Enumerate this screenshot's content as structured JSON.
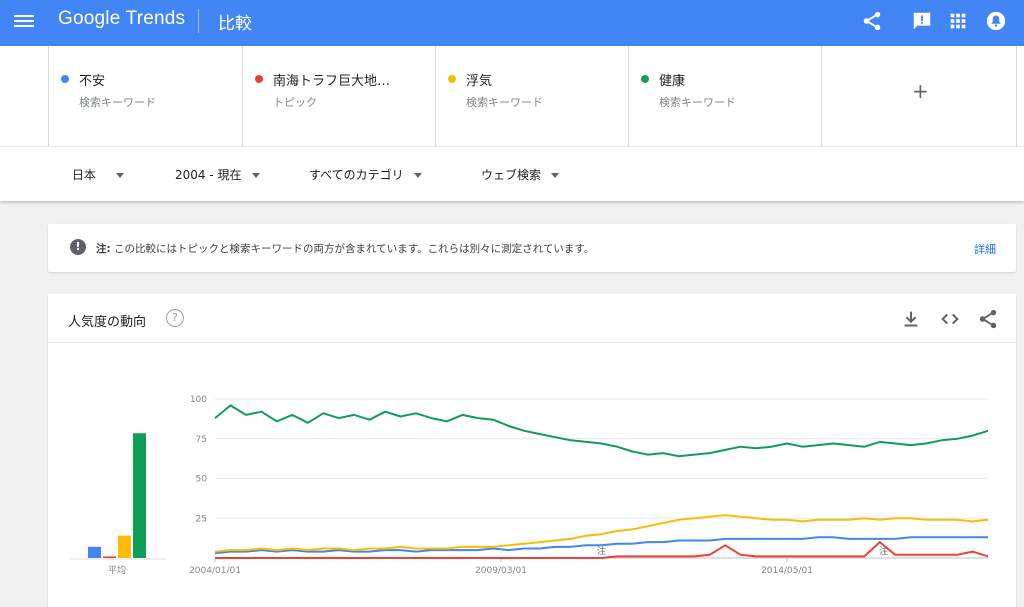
{
  "header": {
    "logo_google": "Google",
    "logo_trends": "Trends",
    "page_title": "比較",
    "icons": [
      "menu-icon",
      "share-icon",
      "feedback-icon",
      "apps-icon",
      "notifications-icon"
    ]
  },
  "terms": [
    {
      "name": "不安",
      "type": "検索キーワード",
      "color": "#4285f4"
    },
    {
      "name": "南海トラフ巨大地…",
      "type": "トピック",
      "color": "#ea4335"
    },
    {
      "name": "浮気",
      "type": "検索キーワード",
      "color": "#fbbc04"
    },
    {
      "name": "健康",
      "type": "検索キーワード",
      "color": "#0f9d58"
    }
  ],
  "add_term_label": "+",
  "filters": {
    "region": "日本",
    "time": "2004 - 現在",
    "category": "すべてのカテゴリ",
    "property": "ウェブ検索"
  },
  "note": {
    "label": "注:",
    "text": "この比較にはトピックと検索キーワードの両方が含まれています。これらは別々に測定されています。",
    "details_label": "詳細"
  },
  "chart_card": {
    "title": "人気度の動向",
    "help_icon": "?",
    "actions": [
      "download-icon",
      "embed-icon",
      "share-icon"
    ]
  },
  "chart_data": {
    "type": "line",
    "y_ticks": [
      "100",
      "75",
      "50",
      "25"
    ],
    "ylim": [
      0,
      100
    ],
    "x_tick_labels": [
      "2004/01/01",
      "2009/03/01",
      "2014/05/01"
    ],
    "x_tick_positions": [
      0,
      0.37,
      0.74
    ],
    "grid": true,
    "annotations": [
      {
        "label": "注",
        "at": 0.5
      },
      {
        "label": "注",
        "at": 0.865
      }
    ],
    "averages": {
      "label": "平均",
      "values": [
        7,
        1,
        14,
        78
      ]
    },
    "series": [
      {
        "name": "不安",
        "color": "#4285f4",
        "values": [
          3,
          4,
          4,
          5,
          4,
          5,
          4,
          4,
          5,
          4,
          4,
          5,
          5,
          4,
          5,
          5,
          5,
          5,
          6,
          5,
          6,
          6,
          7,
          7,
          8,
          8,
          9,
          9,
          10,
          10,
          11,
          11,
          11,
          12,
          12,
          12,
          12,
          12,
          12,
          13,
          13,
          12,
          12,
          12,
          12,
          13,
          13,
          13,
          13,
          13,
          13
        ]
      },
      {
        "name": "南海トラフ巨大地…",
        "color": "#ea4335",
        "values": [
          0,
          0,
          0,
          0,
          0,
          0,
          0,
          0,
          0,
          0,
          0,
          0,
          0,
          0,
          0,
          0,
          0,
          0,
          0,
          0,
          0,
          0,
          0,
          0,
          0,
          0,
          1,
          1,
          1,
          1,
          1,
          1,
          2,
          8,
          2,
          1,
          1,
          1,
          1,
          1,
          1,
          1,
          1,
          10,
          2,
          2,
          2,
          2,
          2,
          4,
          1
        ]
      },
      {
        "name": "浮気",
        "color": "#fbbc04",
        "values": [
          4,
          5,
          5,
          6,
          5,
          6,
          5,
          6,
          6,
          5,
          6,
          6,
          7,
          6,
          6,
          6,
          7,
          7,
          7,
          8,
          9,
          10,
          11,
          12,
          14,
          15,
          17,
          18,
          20,
          22,
          24,
          25,
          26,
          27,
          26,
          25,
          24,
          24,
          23,
          24,
          24,
          24,
          25,
          24,
          25,
          25,
          24,
          24,
          24,
          23,
          24
        ]
      },
      {
        "name": "健康",
        "color": "#0f9d58",
        "values": [
          88,
          96,
          90,
          92,
          86,
          90,
          85,
          91,
          88,
          90,
          87,
          92,
          89,
          91,
          88,
          86,
          90,
          88,
          87,
          83,
          80,
          78,
          76,
          74,
          73,
          72,
          70,
          67,
          65,
          66,
          64,
          65,
          66,
          68,
          70,
          69,
          70,
          72,
          70,
          71,
          72,
          71,
          70,
          73,
          72,
          71,
          72,
          74,
          75,
          77,
          80
        ]
      }
    ]
  }
}
